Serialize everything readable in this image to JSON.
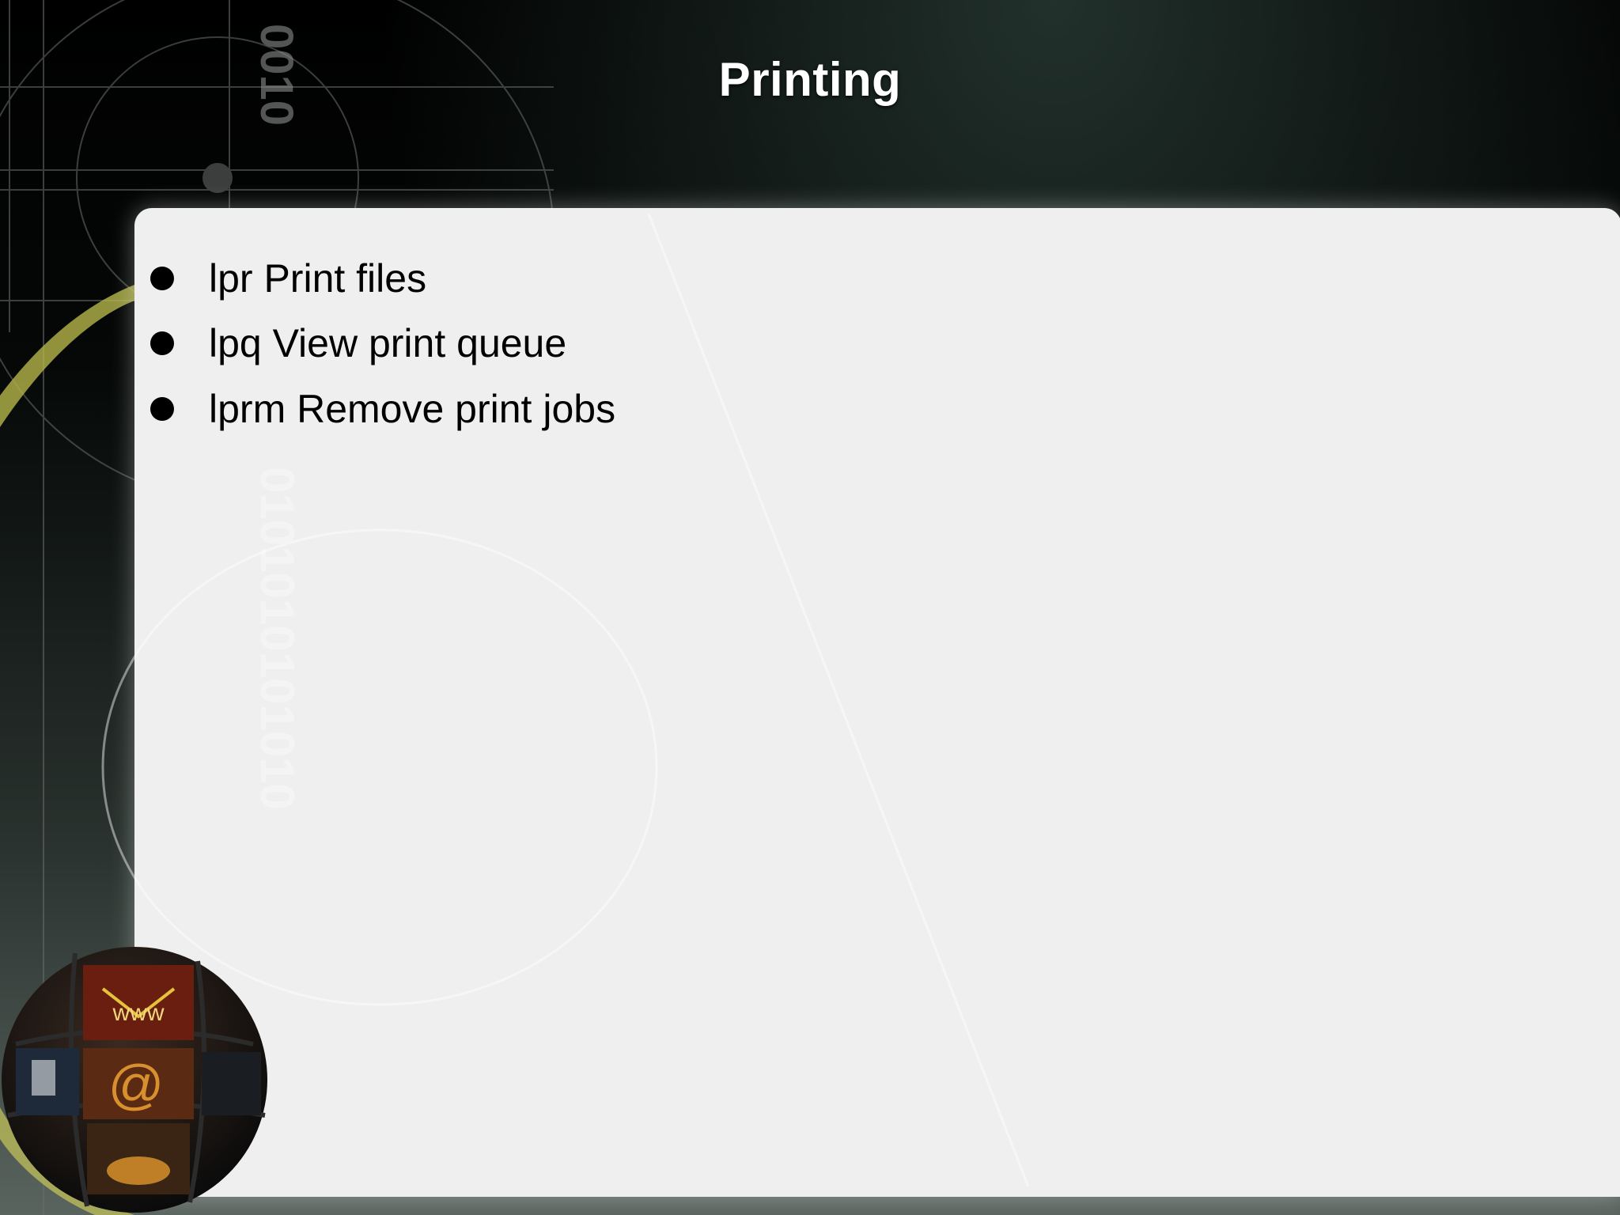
{
  "slide": {
    "title": "Printing",
    "bullets": [
      {
        "text": "lpr Print files"
      },
      {
        "text": "lpq View print queue"
      },
      {
        "text": "lprm Remove print jobs"
      }
    ]
  },
  "globe_tiles": [
    "www",
    "@"
  ],
  "colors": {
    "background": "#000000",
    "panel": "#efefef",
    "title": "#ffffff",
    "text": "#000000",
    "accent": "#c8c85a"
  }
}
